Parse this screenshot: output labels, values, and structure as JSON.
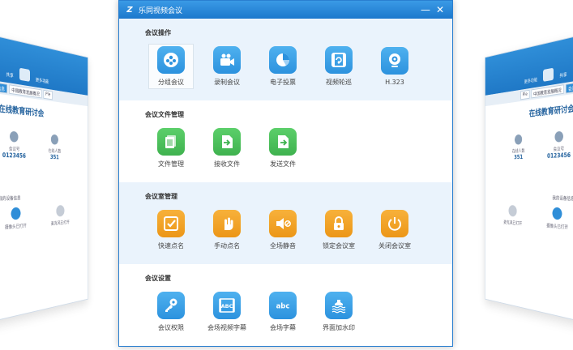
{
  "dialog": {
    "title": "乐同视频会议",
    "minimize": "—",
    "close": "✕"
  },
  "sections": [
    {
      "title": "会议操作",
      "items": [
        {
          "label": "分组会议",
          "icon": "group-icon",
          "color": "#3aa3ea"
        },
        {
          "label": "录制会议",
          "icon": "camera-icon",
          "color": "#3aa3ea"
        },
        {
          "label": "电子投票",
          "icon": "pie-chart-icon",
          "color": "#3aa3ea"
        },
        {
          "label": "视频轮巡",
          "icon": "video-rotate-icon",
          "color": "#3aa3ea"
        },
        {
          "label": "H.323",
          "icon": "webcam-icon",
          "color": "#3aa3ea"
        }
      ]
    },
    {
      "title": "会议文件管理",
      "items": [
        {
          "label": "文件管理",
          "icon": "files-icon",
          "color": "#4cc05c"
        },
        {
          "label": "接收文件",
          "icon": "receive-file-icon",
          "color": "#4cc05c"
        },
        {
          "label": "发送文件",
          "icon": "send-file-icon",
          "color": "#4cc05c"
        }
      ]
    },
    {
      "title": "会议室管理",
      "items": [
        {
          "label": "快速点名",
          "icon": "check-icon",
          "color": "#f2a428"
        },
        {
          "label": "手动点名",
          "icon": "hand-icon",
          "color": "#f2a428"
        },
        {
          "label": "全场静音",
          "icon": "mute-icon",
          "color": "#f2a428"
        },
        {
          "label": "锁定会议室",
          "icon": "lock-icon",
          "color": "#f2a428"
        },
        {
          "label": "关闭会议室",
          "icon": "power-icon",
          "color": "#f2a428"
        }
      ]
    },
    {
      "title": "会议设置",
      "items": [
        {
          "label": "会议权限",
          "icon": "key-icon",
          "color": "#3aa3ea"
        },
        {
          "label": "会场视频字幕",
          "icon": "video-caption-icon",
          "color": "#3aa3ea"
        },
        {
          "label": "会场字幕",
          "icon": "caption-icon",
          "color": "#3aa3ea"
        },
        {
          "label": "界面加水印",
          "icon": "watermark-icon",
          "color": "#3aa3ea"
        }
      ]
    }
  ],
  "left_window": {
    "toolbar": [
      "共享",
      "更多功能"
    ],
    "tabs": [
      "会议信息",
      "中国教育发展概况",
      "Ple"
    ],
    "title": "在线教育研讨会",
    "stats": [
      {
        "label": "会议号",
        "value": "0123456"
      },
      {
        "label": "在线人数",
        "value": "351"
      }
    ],
    "section": "我的设备信息",
    "devices": [
      "摄像头已打开",
      "麦克风已打开"
    ]
  },
  "right_window": {
    "toolbar": [
      "共享",
      "更多功能"
    ],
    "tabs": [
      "会议信息",
      "中国教育发展概况",
      "Ple"
    ],
    "title": "在线教育研讨会",
    "stats": [
      {
        "label": "会议号",
        "value": "0123456"
      },
      {
        "label": "在线人数",
        "value": "351"
      }
    ],
    "section": "我的设备信息",
    "devices": [
      "摄像头已打开",
      "麦克风已打开"
    ]
  }
}
